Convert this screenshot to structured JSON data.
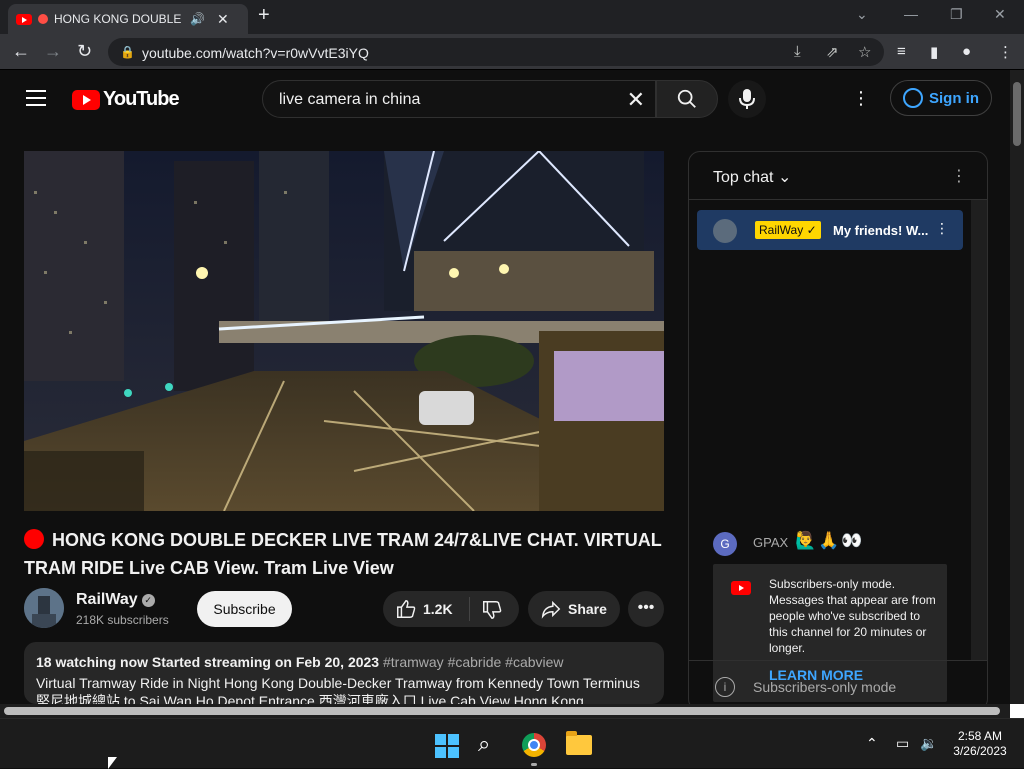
{
  "browser": {
    "tab_title": "HONG KONG DOUBLE D",
    "url": "youtube.com/watch?v=r0wVvtE3iYQ"
  },
  "header": {
    "logo_text": "YouTube",
    "search_query": "live camera in china",
    "sign_in_label": "Sign in"
  },
  "video": {
    "title": "HONG KONG DOUBLE DECKER LIVE TRAM 24/7&LIVE CHAT. VIRTUAL TRAM RIDE Live CAB View. Tram Live View",
    "channel_name": "RailWay",
    "subscribers": "218K subscribers",
    "subscribe_label": "Subscribe",
    "like_count": "1.2K",
    "share_label": "Share"
  },
  "description": {
    "stats": "18 watching now  Started streaming on Feb 20, 2023",
    "tags": "#tramway #cabride #cabview",
    "text": "Virtual Tramway Ride in Night Hong Kong Double-Decker Tramway from Kennedy Town Terminus 堅尼地城總站 to Sai Wan Ho Depot Entrance 西灣河車廠入口 Live Cab View Hong Kong"
  },
  "chat": {
    "header_label": "Top chat",
    "pinned": {
      "author": "RailWay",
      "message": "My friends! W..."
    },
    "messages": [
      {
        "avatar_letter": "G",
        "author": "GPAX",
        "content": "🙋‍♂️🙏👀"
      }
    ],
    "notice_text": "Subscribers-only mode. Messages that appear are from people who've subscribed to this channel for 20 minutes or longer.",
    "learn_more_label": "LEARN MORE",
    "footer_label": "Subscribers-only mode"
  },
  "taskbar": {
    "time": "2:58 AM",
    "date": "3/26/2023"
  },
  "colors": {
    "youtube_red": "#ff0000",
    "link_blue": "#3ea6ff",
    "pinned_bg": "#1f3a63",
    "owner_badge": "#ffd600"
  }
}
